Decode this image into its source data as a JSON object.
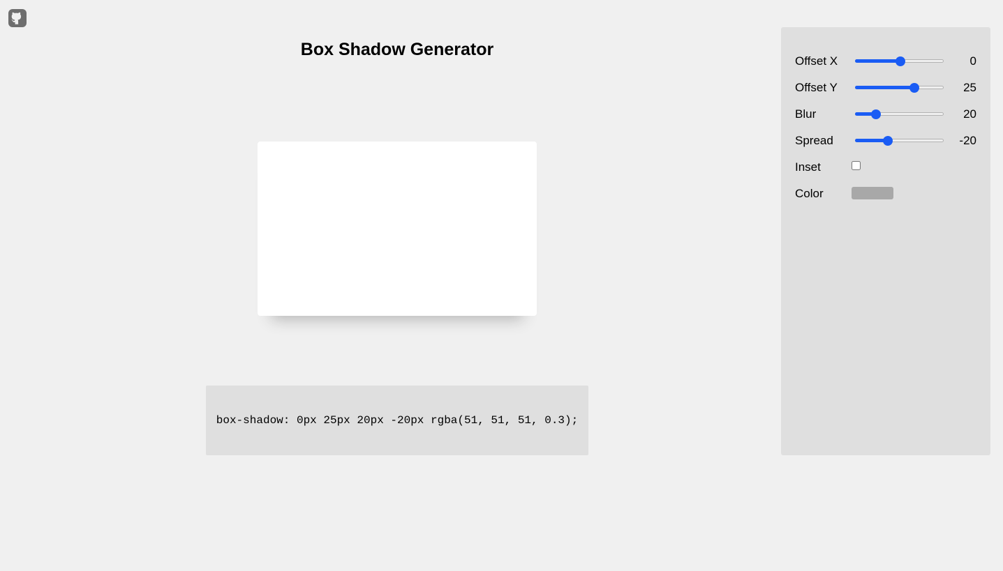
{
  "page": {
    "title": "Box Shadow Generator"
  },
  "code": {
    "text": "box-shadow: 0px 25px 20px -20px rgba(51, 51, 51, 0.3);"
  },
  "controls": {
    "offset_x": {
      "label": "Offset X",
      "value": "0",
      "fraction": 0.51
    },
    "offset_y": {
      "label": "Offset Y",
      "value": "25",
      "fraction": 0.67
    },
    "blur": {
      "label": "Blur",
      "value": "20",
      "fraction": 0.235
    },
    "spread": {
      "label": "Spread",
      "value": "-20",
      "fraction": 0.37
    },
    "inset": {
      "label": "Inset",
      "checked": false
    },
    "color": {
      "label": "Color",
      "value": "#a8a8a8"
    }
  },
  "colors": {
    "accent": "#1a5cf4",
    "background": "#f0f0f0",
    "panel": "#dfdfdf",
    "preview": "#ffffff",
    "icon": "#6e6e6e"
  },
  "icons": {
    "github": "github-icon"
  }
}
